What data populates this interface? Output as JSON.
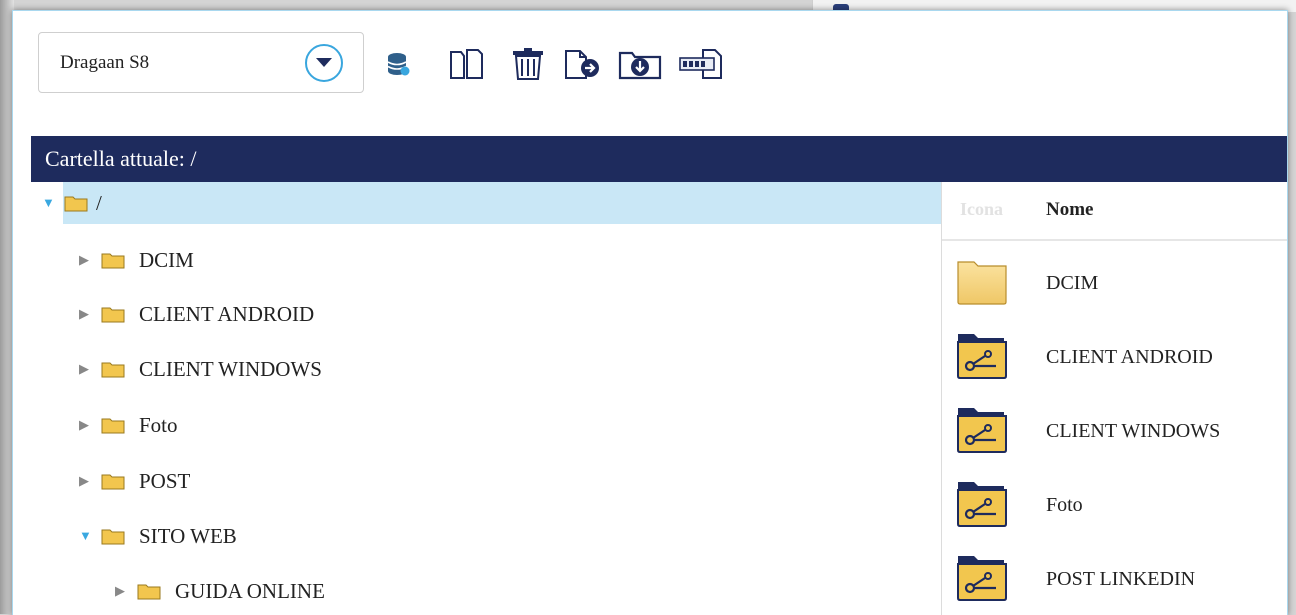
{
  "toolbar": {
    "device_selector": {
      "value": "Dragaan S8"
    },
    "buttons": [
      {
        "name": "database-button",
        "icon": "database-icon"
      },
      {
        "name": "copy-button",
        "icon": "copy-icon"
      },
      {
        "name": "delete-button",
        "icon": "trash-icon"
      },
      {
        "name": "move-button",
        "icon": "file-move-icon"
      },
      {
        "name": "download-button",
        "icon": "folder-download-icon"
      },
      {
        "name": "rename-button",
        "icon": "rename-icon"
      }
    ]
  },
  "path_bar": {
    "text": "Cartella attuale: /"
  },
  "tree": {
    "root": {
      "label": "/",
      "expanded": true
    },
    "items": [
      {
        "label": "DCIM",
        "expanded": false
      },
      {
        "label": "CLIENT ANDROID",
        "expanded": false
      },
      {
        "label": "CLIENT WINDOWS",
        "expanded": false
      },
      {
        "label": "Foto",
        "expanded": false
      },
      {
        "label": "POST",
        "expanded": false
      },
      {
        "label": "SITO WEB",
        "expanded": true
      },
      {
        "label": "GUIDA ONLINE",
        "expanded": false
      }
    ]
  },
  "file_list": {
    "columns": {
      "icon": "Icona",
      "name": "Nome"
    },
    "rows": [
      {
        "name": "DCIM",
        "icon": "folder-icon"
      },
      {
        "name": "CLIENT ANDROID",
        "icon": "shared-folder-icon"
      },
      {
        "name": "CLIENT WINDOWS",
        "icon": "shared-folder-icon"
      },
      {
        "name": "Foto",
        "icon": "shared-folder-icon"
      },
      {
        "name": "POST LINKEDIN",
        "icon": "shared-folder-icon"
      }
    ]
  },
  "colors": {
    "path_bar_bg": "#1e2b5d",
    "selected_row": "#c9e7f6",
    "accent": "#39a6de",
    "folder": "#f2c64e"
  }
}
